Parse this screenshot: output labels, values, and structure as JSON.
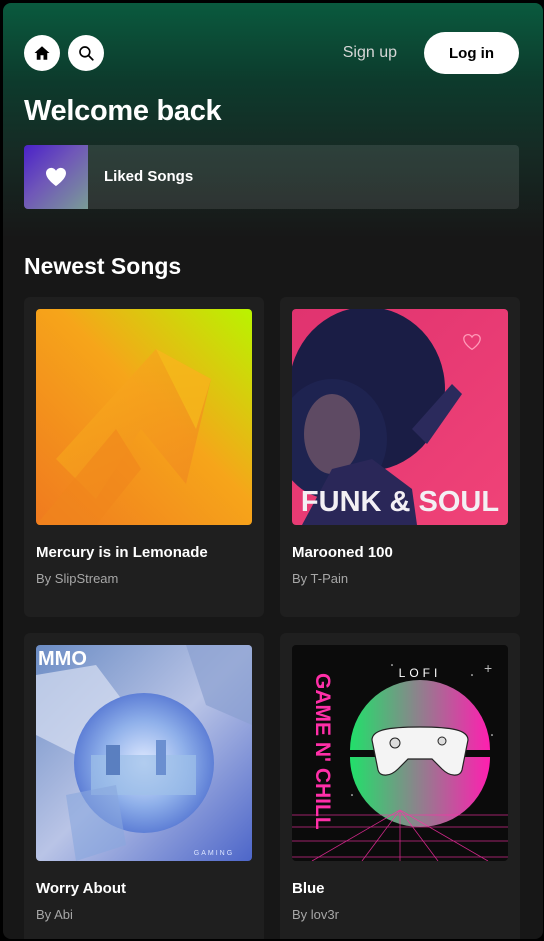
{
  "header": {
    "home_icon": "home-icon",
    "search_icon": "search-icon",
    "signup_label": "Sign up",
    "login_label": "Log in"
  },
  "welcome_title": "Welcome back",
  "liked": {
    "label": "Liked Songs",
    "icon": "heart-icon"
  },
  "section_title": "Newest Songs",
  "songs": [
    {
      "title": "Mercury is in Lemonade",
      "artist": "By SlipStream"
    },
    {
      "title": "Marooned 100",
      "artist": "By T-Pain",
      "cover_text": "FUNK & SOUL"
    },
    {
      "title": "Worry About",
      "artist": "By Abi",
      "cover_text": "MMO",
      "cover_subtext": "GAMING"
    },
    {
      "title": "Blue",
      "artist": "By lov3r",
      "cover_text": "LOFI",
      "cover_vertical": "GAME N' CHILL"
    }
  ],
  "colors": {
    "accent": "#1db954",
    "card_bg": "#1f1f1f",
    "muted_text": "#a7a7a7"
  }
}
